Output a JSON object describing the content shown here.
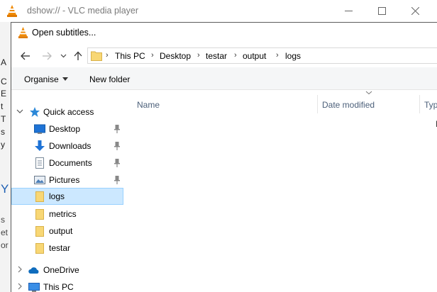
{
  "vlc": {
    "title": "dshow:// - VLC media player",
    "left_fragments": [
      "A",
      "C",
      "E",
      "t",
      "T",
      "s",
      "y",
      "Y",
      "s",
      "et",
      "or"
    ],
    "controls": {
      "minimize": "—",
      "maximize": "☐",
      "close": "✕"
    }
  },
  "dialog": {
    "title": "Open subtitles...",
    "nav": {
      "back": "back-arrow-icon",
      "forward": "forward-arrow-icon",
      "recent": "chevron-down-icon",
      "up": "up-arrow-icon"
    },
    "address": {
      "crumbs": [
        "This PC",
        "Desktop",
        "testar",
        "output",
        "logs"
      ]
    },
    "toolbar": {
      "organise": "Organise",
      "new_folder": "New folder"
    },
    "sidebar": {
      "quick_access": "Quick access",
      "items": [
        {
          "label": "Desktop",
          "icon": "desktop-icon",
          "pinned": true
        },
        {
          "label": "Downloads",
          "icon": "downloads-icon",
          "pinned": true
        },
        {
          "label": "Documents",
          "icon": "documents-icon",
          "pinned": true
        },
        {
          "label": "Pictures",
          "icon": "pictures-icon",
          "pinned": true
        },
        {
          "label": "logs",
          "icon": "folder-icon",
          "pinned": false,
          "selected": true
        },
        {
          "label": "metrics",
          "icon": "folder-icon",
          "pinned": false
        },
        {
          "label": "output",
          "icon": "folder-icon",
          "pinned": false
        },
        {
          "label": "testar",
          "icon": "folder-icon",
          "pinned": false
        }
      ],
      "onedrive": "OneDrive",
      "this_pc": "This PC"
    },
    "columns": {
      "name": "Name",
      "date_modified": "Date modified",
      "type": "Type"
    },
    "overflow_char": "N"
  },
  "colors": {
    "selected_bg": "#cce8ff",
    "selected_border": "#99d1ff",
    "folder": "#f3cd5a",
    "accent_blue": "#1e73d6"
  }
}
